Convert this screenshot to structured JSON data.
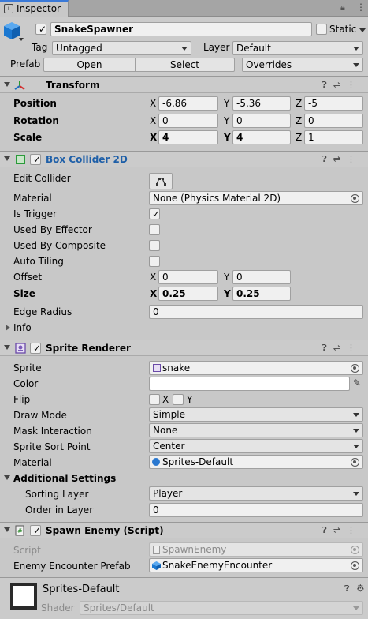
{
  "tab": {
    "label": "Inspector"
  },
  "object": {
    "name": "SnakeSpawner",
    "static_label": "Static",
    "tag_label": "Tag",
    "tag_value": "Untagged",
    "layer_label": "Layer",
    "layer_value": "Default",
    "prefab_label": "Prefab",
    "open_label": "Open",
    "select_label": "Select",
    "overrides_label": "Overrides"
  },
  "transform": {
    "title": "Transform",
    "position_label": "Position",
    "rotation_label": "Rotation",
    "scale_label": "Scale",
    "x": "X",
    "y": "Y",
    "z": "Z",
    "position": [
      "-6.86",
      "-5.36",
      "-5"
    ],
    "rotation": [
      "0",
      "0",
      "0"
    ],
    "scale": [
      "4",
      "4",
      "1"
    ]
  },
  "box_collider": {
    "title": "Box Collider 2D",
    "edit_collider_label": "Edit Collider",
    "material_label": "Material",
    "material_value": "None (Physics Material 2D)",
    "is_trigger_label": "Is Trigger",
    "used_by_effector_label": "Used By Effector",
    "used_by_composite_label": "Used By Composite",
    "auto_tiling_label": "Auto Tiling",
    "offset_label": "Offset",
    "offset": [
      "0",
      "0"
    ],
    "size_label": "Size",
    "size": [
      "0.25",
      "0.25"
    ],
    "edge_radius_label": "Edge Radius",
    "edge_radius": "0",
    "info_label": "Info"
  },
  "sprite_renderer": {
    "title": "Sprite Renderer",
    "sprite_label": "Sprite",
    "sprite_value": "snake",
    "color_label": "Color",
    "flip_label": "Flip",
    "flip_x": "X",
    "flip_y": "Y",
    "draw_mode_label": "Draw Mode",
    "draw_mode_value": "Simple",
    "mask_label": "Mask Interaction",
    "mask_value": "None",
    "sort_point_label": "Sprite Sort Point",
    "sort_point_value": "Center",
    "material_label": "Material",
    "material_value": "Sprites-Default",
    "additional_label": "Additional Settings",
    "sorting_layer_label": "Sorting Layer",
    "sorting_layer_value": "Player",
    "order_label": "Order in Layer",
    "order_value": "0"
  },
  "spawn_enemy": {
    "title": "Spawn Enemy (Script)",
    "script_label": "Script",
    "script_value": "SpawnEnemy",
    "prefab_label": "Enemy Encounter Prefab",
    "prefab_value": "SnakeEnemyEncounter"
  },
  "material_footer": {
    "name": "Sprites-Default",
    "shader_label": "Shader",
    "shader_value": "Sprites/Default"
  },
  "colors": {
    "accent_blue": "#1e6fbf",
    "header_bg": "#cbcbcb",
    "panel_bg": "#c8c8c8"
  }
}
